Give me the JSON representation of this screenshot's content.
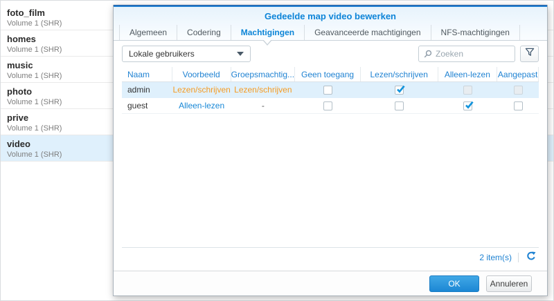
{
  "sidebar": {
    "items": [
      {
        "name": "foto_film",
        "volume": "Volume 1 (SHR)",
        "selected": false
      },
      {
        "name": "homes",
        "volume": "Volume 1 (SHR)",
        "selected": false
      },
      {
        "name": "music",
        "volume": "Volume 1 (SHR)",
        "selected": false
      },
      {
        "name": "photo",
        "volume": "Volume 1 (SHR)",
        "selected": false
      },
      {
        "name": "prive",
        "volume": "Volume 1 (SHR)",
        "selected": false
      },
      {
        "name": "video",
        "volume": "Volume 1 (SHR)",
        "selected": true
      }
    ]
  },
  "dialog": {
    "title": "Gedeelde map video bewerken",
    "tabs": [
      {
        "label": "Algemeen",
        "active": false
      },
      {
        "label": "Codering",
        "active": false
      },
      {
        "label": "Machtigingen",
        "active": true
      },
      {
        "label": "Geavanceerde machtigingen",
        "active": false
      },
      {
        "label": "NFS-machtigingen",
        "active": false
      }
    ],
    "toolbar": {
      "user_source_value": "Lokale gebruikers",
      "search_placeholder": "Zoeken"
    },
    "table": {
      "columns": [
        "Naam",
        "Voorbeeld",
        "Groepsmachtig...",
        "Geen toegang",
        "Lezen/schrijven",
        "Alleen-lezen",
        "Aangepast"
      ],
      "rows": [
        {
          "name": "admin",
          "preview": "Lezen/schrijven",
          "preview_style": "orange",
          "group_permission": "Lezen/schrijven",
          "group_permission_style": "orange",
          "no_access": "unchecked",
          "read_write": "checked",
          "read_only": "disabled",
          "custom": "disabled",
          "selected": true
        },
        {
          "name": "guest",
          "preview": "Alleen-lezen",
          "preview_style": "blue",
          "group_permission": "-",
          "group_permission_style": "plain",
          "no_access": "unchecked",
          "read_write": "unchecked",
          "read_only": "checked",
          "custom": "unchecked",
          "selected": false
        }
      ]
    },
    "status": {
      "count": "2 item(s)"
    },
    "footer": {
      "ok": "OK",
      "cancel": "Annuleren"
    }
  },
  "colors": {
    "accent_blue": "#1f7fd0",
    "link_blue": "#1787d6",
    "header_blue": "#1f82d2",
    "orange": "#f59b22",
    "check_blue": "#1494dc",
    "selected_row": "#dff0fc"
  }
}
